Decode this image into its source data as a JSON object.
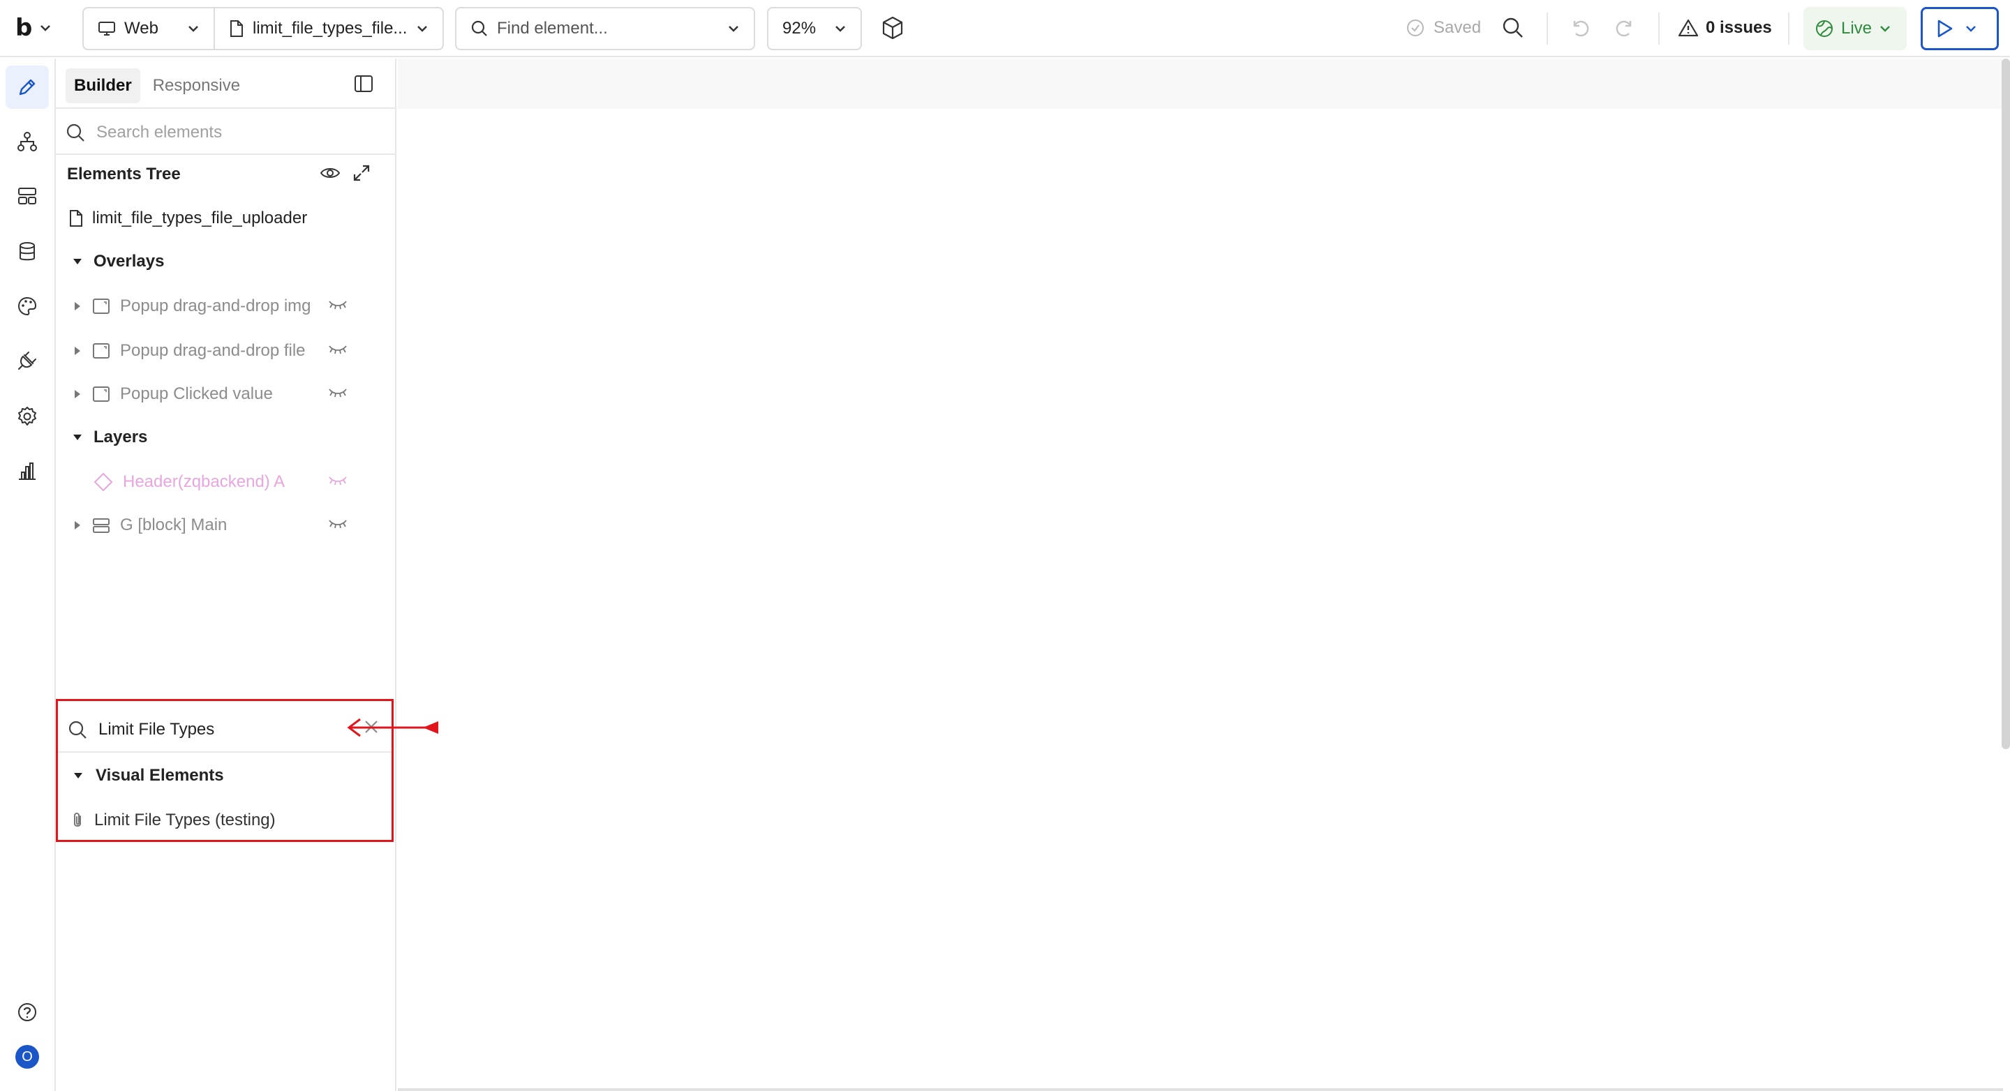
{
  "app": {
    "logo_text": "b",
    "platform_label": "Web",
    "page_label": "limit_file_types_file...",
    "find_placeholder": "Find element...",
    "zoom_label": "92%",
    "saved_label": "Saved",
    "issues_label": "0 issues",
    "live_label": "Live"
  },
  "panel": {
    "tabs": [
      {
        "label": "Builder"
      },
      {
        "label": "Responsive"
      }
    ],
    "search_placeholder": "Search elements",
    "tree_title": "Elements Tree",
    "page_name": "limit_file_types_file_uploader",
    "overlays_label": "Overlays",
    "overlays": [
      {
        "label": "Popup drag-and-drop img"
      },
      {
        "label": "Popup drag-and-drop file"
      },
      {
        "label": "Popup Clicked value"
      }
    ],
    "layers_label": "Layers",
    "layers": [
      {
        "label": "Header(zqbackend) A"
      },
      {
        "label": "G [block] Main"
      }
    ]
  },
  "search_result": {
    "query": "Limit File Types",
    "section_label": "Visual Elements",
    "items": [
      {
        "label": "Limit File Types (testing)"
      }
    ]
  },
  "rail": {
    "avatar_letter": "O"
  },
  "colors": {
    "accent": "#1a56c7",
    "annotation": "#e0161c",
    "live": "#2e8b3e",
    "reusable_pink": "#e8a6df"
  }
}
